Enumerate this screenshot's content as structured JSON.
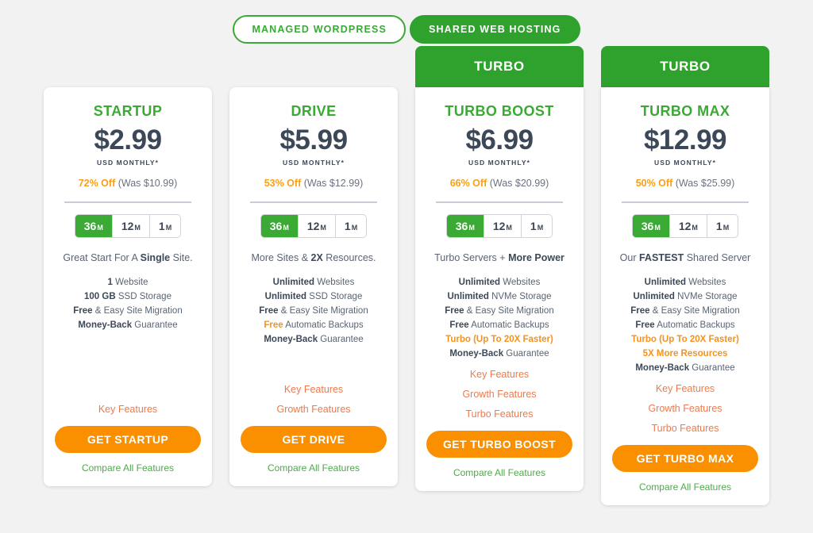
{
  "toggle": {
    "options": [
      {
        "label": "MANAGED WORDPRESS",
        "active": false
      },
      {
        "label": "SHARED WEB HOSTING",
        "active": true
      }
    ]
  },
  "colors": {
    "green": "#3aaa35",
    "banner_green": "#2ea22c",
    "orange": "#f5921e",
    "cta_orange": "#fa9000",
    "link_orange": "#f0794b",
    "compare_green": "#4fa94d",
    "dark": "#3c4858",
    "page_bg": "#f2f2f2"
  },
  "cards": [
    {
      "banner": "",
      "plan": "STARTUP",
      "price": "$2.99",
      "usd": "USD MONTHLY*",
      "discount_pct": "72% Off",
      "discount_was": "(Was $10.99)",
      "terms": [
        {
          "num": "36",
          "unit": "M",
          "selected": true
        },
        {
          "num": "12",
          "unit": "M",
          "selected": false
        },
        {
          "num": "1",
          "unit": "M",
          "selected": false
        }
      ],
      "tagline_pre": "Great Start For A ",
      "tagline_bold": "Single",
      "tagline_post": " Site.",
      "features": [
        {
          "bold": "1",
          "rest": " Website",
          "orange": false
        },
        {
          "bold": "100 GB",
          "rest": " SSD Storage",
          "orange": false
        },
        {
          "bold": "Free",
          "rest": " & Easy Site Migration",
          "orange": false
        },
        {
          "bold": "Money-Back",
          "rest": " Guarantee",
          "orange": false
        }
      ],
      "links": [
        "Key Features"
      ],
      "cta": "GET STARTUP",
      "compare": "Compare All Features"
    },
    {
      "banner": "",
      "plan": "DRIVE",
      "price": "$5.99",
      "usd": "USD MONTHLY*",
      "discount_pct": "53% Off",
      "discount_was": "(Was $12.99)",
      "terms": [
        {
          "num": "36",
          "unit": "M",
          "selected": true
        },
        {
          "num": "12",
          "unit": "M",
          "selected": false
        },
        {
          "num": "1",
          "unit": "M",
          "selected": false
        }
      ],
      "tagline_pre": "More Sites & ",
      "tagline_bold": "2X",
      "tagline_post": " Resources.",
      "features": [
        {
          "bold": "Unlimited",
          "rest": " Websites",
          "orange": false
        },
        {
          "bold": "Unlimited",
          "rest": " SSD Storage",
          "orange": false
        },
        {
          "bold": "Free",
          "rest": " & Easy Site Migration",
          "orange": false
        },
        {
          "bold": "Free",
          "rest": " Automatic Backups",
          "orange": false,
          "bold_orange": true
        },
        {
          "bold": "Money-Back",
          "rest": " Guarantee",
          "orange": false
        }
      ],
      "links": [
        "Key Features",
        "Growth Features"
      ],
      "cta": "GET DRIVE",
      "compare": "Compare All Features"
    },
    {
      "banner": "TURBO",
      "plan": "TURBO BOOST",
      "price": "$6.99",
      "usd": "USD MONTHLY*",
      "discount_pct": "66% Off",
      "discount_was": "(Was $20.99)",
      "terms": [
        {
          "num": "36",
          "unit": "M",
          "selected": true
        },
        {
          "num": "12",
          "unit": "M",
          "selected": false
        },
        {
          "num": "1",
          "unit": "M",
          "selected": false
        }
      ],
      "tagline_pre": "Turbo Servers + ",
      "tagline_bold": "More Power",
      "tagline_post": "",
      "features": [
        {
          "bold": "Unlimited",
          "rest": " Websites",
          "orange": false
        },
        {
          "bold": "Unlimited",
          "rest": " NVMe Storage",
          "orange": false
        },
        {
          "bold": "Free",
          "rest": " & Easy Site Migration",
          "orange": false
        },
        {
          "bold": "Free",
          "rest": " Automatic Backups",
          "orange": false
        },
        {
          "bold": "Turbo (Up To 20X Faster)",
          "rest": "",
          "orange": true
        },
        {
          "bold": "Money-Back",
          "rest": " Guarantee",
          "orange": false
        }
      ],
      "links": [
        "Key Features",
        "Growth Features",
        "Turbo Features"
      ],
      "cta": "GET TURBO BOOST",
      "compare": "Compare All Features"
    },
    {
      "banner": "TURBO",
      "plan": "TURBO MAX",
      "price": "$12.99",
      "usd": "USD MONTHLY*",
      "discount_pct": "50% Off",
      "discount_was": "(Was $25.99)",
      "terms": [
        {
          "num": "36",
          "unit": "M",
          "selected": true
        },
        {
          "num": "12",
          "unit": "M",
          "selected": false
        },
        {
          "num": "1",
          "unit": "M",
          "selected": false
        }
      ],
      "tagline_pre": "Our ",
      "tagline_bold": "FASTEST",
      "tagline_post": " Shared Server",
      "features": [
        {
          "bold": "Unlimited",
          "rest": " Websites",
          "orange": false
        },
        {
          "bold": "Unlimited",
          "rest": " NVMe Storage",
          "orange": false
        },
        {
          "bold": "Free",
          "rest": " & Easy Site Migration",
          "orange": false
        },
        {
          "bold": "Free",
          "rest": " Automatic Backups",
          "orange": false
        },
        {
          "bold": "Turbo (Up To 20X Faster)",
          "rest": "",
          "orange": true
        },
        {
          "bold": "5X More Resources",
          "rest": "",
          "orange": true
        },
        {
          "bold": "Money-Back",
          "rest": " Guarantee",
          "orange": false
        }
      ],
      "links": [
        "Key Features",
        "Growth Features",
        "Turbo Features"
      ],
      "cta": "GET TURBO MAX",
      "compare": "Compare All Features"
    }
  ]
}
